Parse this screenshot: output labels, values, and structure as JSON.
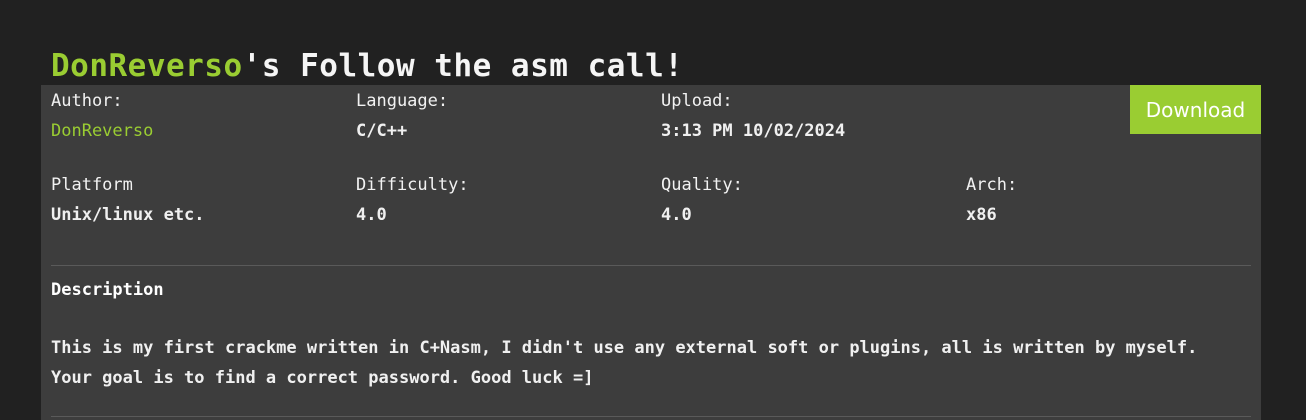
{
  "header": {
    "author_name": "DonReverso",
    "title_suffix": "'s Follow the asm call!"
  },
  "info": {
    "author_label": "Author:",
    "author_value": "DonReverso",
    "language_label": "Language:",
    "language_value": "C/C++",
    "upload_label": "Upload:",
    "upload_value": "3:13 PM 10/02/2024",
    "platform_label": "Platform",
    "platform_value": "Unix/linux etc.",
    "difficulty_label": "Difficulty:",
    "difficulty_value": "4.0",
    "quality_label": "Quality:",
    "quality_value": "4.0",
    "arch_label": "Arch:",
    "arch_value": "x86"
  },
  "actions": {
    "download_label": "Download"
  },
  "description": {
    "heading": "Description",
    "text": "This is my first crackme written in C+Nasm, I didn't use any external soft or plugins, all is written by myself. Your goal is to find a correct password. Good luck =]"
  },
  "colors": {
    "accent": "#9acd32",
    "page_bg": "#212121",
    "card_bg": "#3d3d3d"
  }
}
